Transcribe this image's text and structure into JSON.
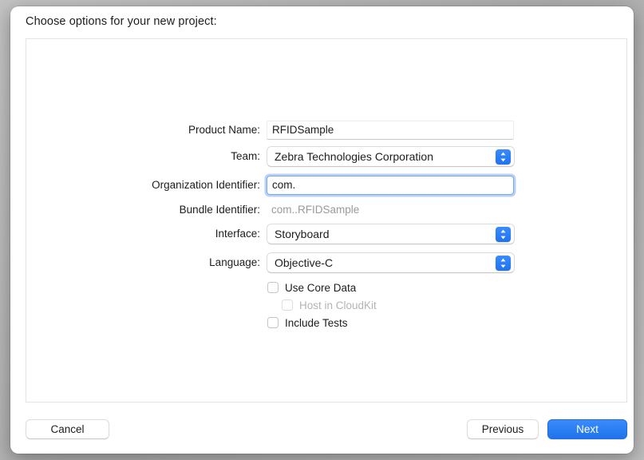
{
  "dialog": {
    "title": "Choose options for your new project:"
  },
  "form": {
    "rows": [
      {
        "label": "Product Name:",
        "value": "RFIDSample",
        "kind": "textfield"
      },
      {
        "label": "Team:",
        "value": "Zebra Technologies Corporation",
        "kind": "popup"
      },
      {
        "label": "Organization Identifier:",
        "value": "com.",
        "kind": "textfield-focused"
      },
      {
        "label": "Bundle Identifier:",
        "value": "com..RFIDSample",
        "kind": "static"
      },
      {
        "label": "Interface:",
        "value": "Storyboard",
        "kind": "popup"
      },
      {
        "label": "Language:",
        "value": "Objective-C",
        "kind": "popup"
      }
    ],
    "checkboxes": [
      {
        "label": "Use Core Data",
        "checked": false,
        "enabled": true
      },
      {
        "label": "Host in CloudKit",
        "checked": false,
        "enabled": false
      },
      {
        "label": "Include Tests",
        "checked": false,
        "enabled": true
      }
    ]
  },
  "footer": {
    "cancel_label": "Cancel",
    "previous_label": "Previous",
    "next_label": "Next"
  },
  "colors": {
    "accent": "#2b7fee",
    "focus_ring": "#7aa7f0",
    "disabled_text": "#b4b4b8",
    "static_text": "#9a9a9e"
  }
}
